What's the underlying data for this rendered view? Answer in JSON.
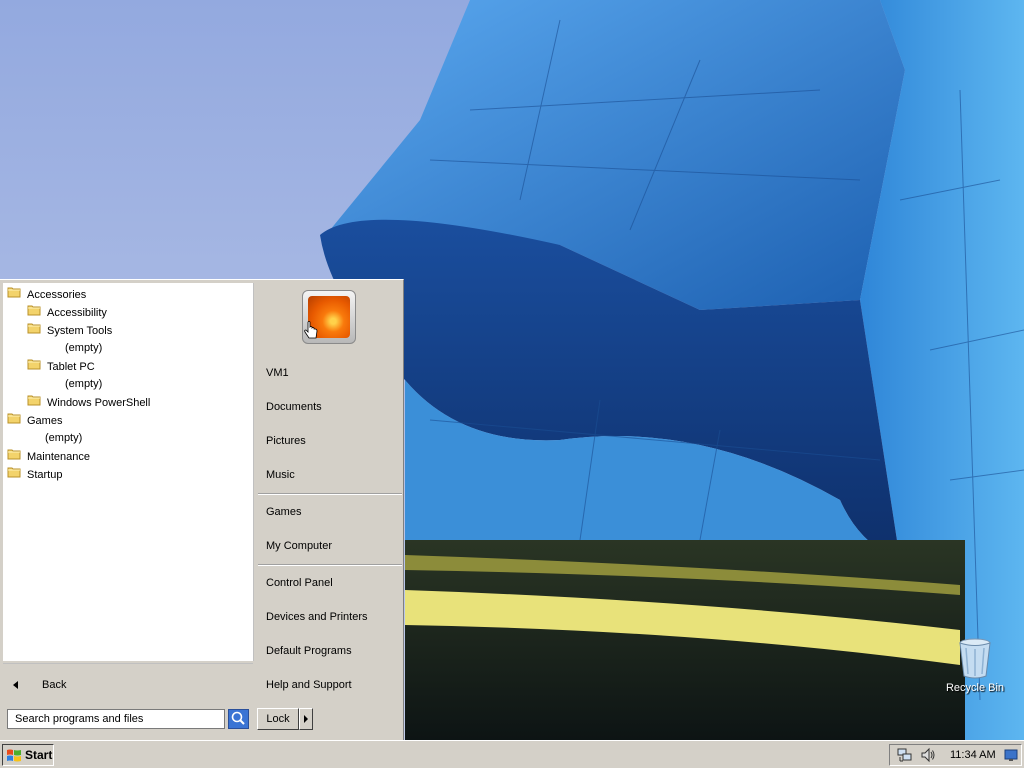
{
  "desktop": {
    "recycle_bin_label": "Recycle Bin"
  },
  "start_menu": {
    "programs": [
      {
        "label": "Accessories",
        "type": "folder",
        "level": 0
      },
      {
        "label": "Accessibility",
        "type": "folder",
        "level": 1
      },
      {
        "label": "System Tools",
        "type": "folder",
        "level": 1
      },
      {
        "label": "(empty)",
        "type": "empty",
        "level": 2
      },
      {
        "label": "Tablet PC",
        "type": "folder",
        "level": 1
      },
      {
        "label": "(empty)",
        "type": "empty",
        "level": 2
      },
      {
        "label": "Windows PowerShell",
        "type": "folder",
        "level": 1
      },
      {
        "label": "Games",
        "type": "folder",
        "level": 0
      },
      {
        "label": "(empty)",
        "type": "empty",
        "level": 1
      },
      {
        "label": "Maintenance",
        "type": "folder",
        "level": 0
      },
      {
        "label": "Startup",
        "type": "folder",
        "level": 0
      }
    ],
    "back_label": "Back",
    "search_placeholder": "Search programs and files",
    "right_items": {
      "user": "VM1",
      "documents": "Documents",
      "pictures": "Pictures",
      "music": "Music",
      "games": "Games",
      "my_computer": "My Computer",
      "control_panel": "Control Panel",
      "devices_printers": "Devices and Printers",
      "default_programs": "Default Programs",
      "help_support": "Help and Support"
    },
    "lock_label": "Lock"
  },
  "taskbar": {
    "start_label": "Start",
    "clock": "11:34 AM"
  },
  "colors": {
    "classic_face": "#d4d0c8",
    "wallpaper_blue": "#2a78c8",
    "folder_yellow": "#f3d36b"
  }
}
